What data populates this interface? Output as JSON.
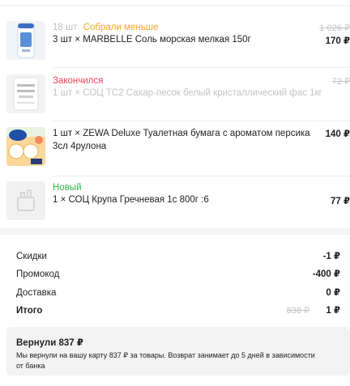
{
  "items": [
    {
      "count": "18 шт",
      "status": "Собрали меньше",
      "title": "3 шт × MARBELLE Соль морская мелкая 150г",
      "old_price": "1 026 ₽",
      "price": "170 ₽"
    },
    {
      "status": "Закончился",
      "title": "1 шт × СОЦ ТС2 Сахар-песок белый кристаллический фас 1кг",
      "old_price": "72 ₽"
    },
    {
      "title": "1 шт × ZEWA Deluxe Туалетная бумага с ароматом персика 3сл 4рулона",
      "price": "140 ₽"
    },
    {
      "status": "Новый",
      "title": "1 × СОЦ Крупа Гречневая 1с 800г :6",
      "price": "77 ₽"
    }
  ],
  "summary": {
    "discounts_label": "Скидки",
    "discounts_value": "-1 ₽",
    "promo_label": "Промокод",
    "promo_value": "-400 ₽",
    "delivery_label": "Доставка",
    "delivery_value": "0 ₽",
    "total_label": "Итого",
    "total_old": "838 ₽",
    "total_value": "1 ₽"
  },
  "refund": {
    "title": "Вернули 837 ₽",
    "text": "Мы вернули на вашу карту 837 ₽ за товары. Возврат занимает до 5 дней в зависимости от банка"
  },
  "colors": {
    "partial": "#f5a623",
    "out_of_stock": "#e8445a",
    "new": "#2fb84a"
  }
}
